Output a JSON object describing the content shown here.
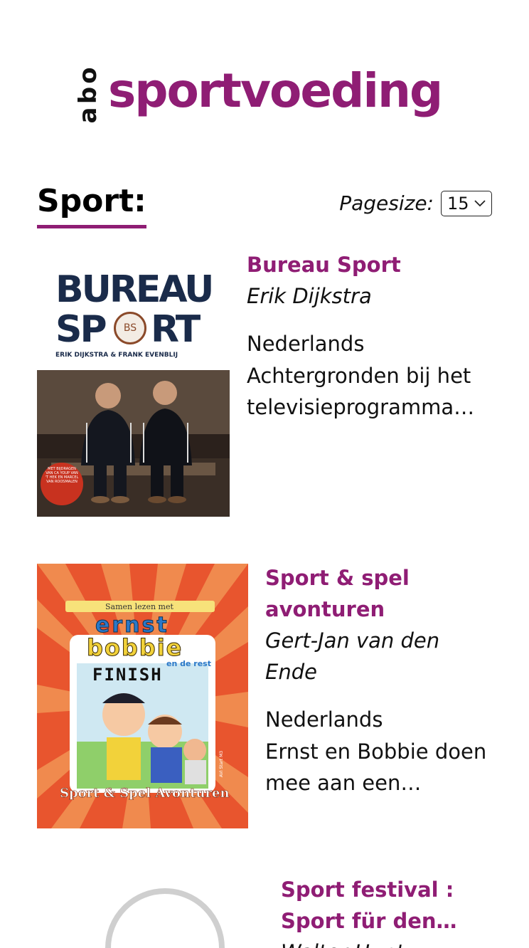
{
  "header": {
    "logo_letters": [
      "o",
      "b",
      "a"
    ],
    "title": "sportvoeding",
    "brand_color": "#8f1d74"
  },
  "section": {
    "title": "Sport:",
    "pagesize_label": "Pagesize:",
    "pagesize_value": "15"
  },
  "books": [
    {
      "title": "Bureau Sport",
      "author": "Erik Dijkstra",
      "language": "Nederlands",
      "description": "Achtergronden bij het televisieprogramma…",
      "cover": {
        "title_line1": "BUREAU",
        "title_line2_a": "SP",
        "title_line2_b": "RT",
        "emblem": "BS",
        "authors": "ERIK DIJKSTRA & FRANK EVENBLIJ",
        "badge": "MET BIJDRAGEN VAN CA YOUP VAN 'T HEK EN MARCEL VAN ROOSMALEN"
      }
    },
    {
      "title": "Sport & spel avonturen",
      "author": "Gert-Jan van den Ende",
      "language": "Nederlands",
      "description": "Ernst en Bobbie doen mee aan een…",
      "cover": {
        "series": "Samen lezen met",
        "name1": "ernst",
        "name2": "bobbie",
        "subtitle": "en de rest",
        "banner": "FINISH",
        "bottom": "Sport & Spel Avonturen",
        "publisher": "AVI Start M3"
      }
    },
    {
      "title": "Sport festival : Sport für den…",
      "author": "Walter Hunt"
    }
  ]
}
